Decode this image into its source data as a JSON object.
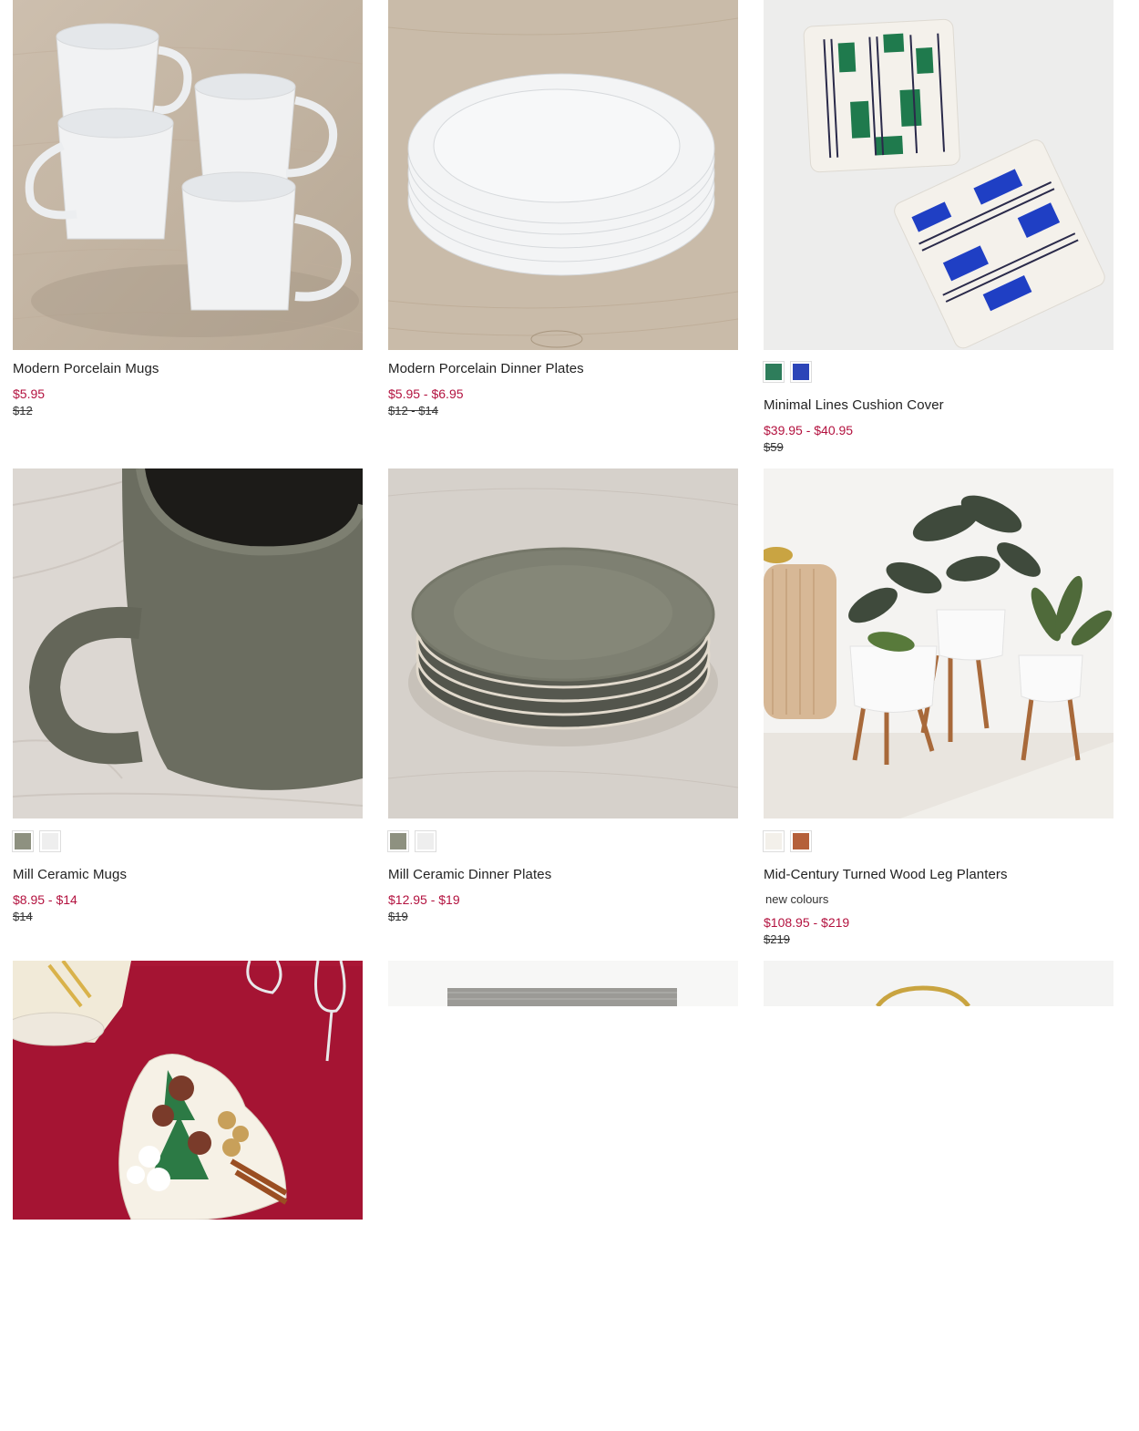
{
  "products": [
    {
      "title": "Modern Porcelain Mugs",
      "sale_price": "$5.95",
      "original_price": "$12",
      "image": "white-porcelain-mugs-image",
      "swatches": []
    },
    {
      "title": "Modern Porcelain Dinner Plates",
      "sale_price": "$5.95 - $6.95",
      "original_price": "$12 - $14",
      "image": "white-porcelain-plates-image",
      "swatches": []
    },
    {
      "title": "Minimal Lines Cushion Cover",
      "sale_price": "$39.95 - $40.95",
      "original_price": "$59",
      "image": "cushion-covers-image",
      "swatches": [
        {
          "color": "#2e7d5b",
          "name": "green"
        },
        {
          "color": "#2c45b8",
          "name": "blue"
        }
      ]
    },
    {
      "title": "Mill Ceramic Mugs",
      "sale_price": "$8.95 - $14",
      "original_price": "$14",
      "image": "olive-ceramic-mug-image",
      "swatches": [
        {
          "color": "#8e9180",
          "name": "olive"
        },
        {
          "color": "#eeeeee",
          "name": "white"
        }
      ]
    },
    {
      "title": "Mill Ceramic Dinner Plates",
      "sale_price": "$12.95 - $19",
      "original_price": "$19",
      "image": "olive-ceramic-plates-image",
      "swatches": [
        {
          "color": "#8e9180",
          "name": "olive"
        },
        {
          "color": "#eeeeee",
          "name": "white"
        }
      ]
    },
    {
      "title": "Mid-Century Turned Wood Leg Planters",
      "note": "new colours",
      "sale_price": "$108.95 - $219",
      "original_price": "$219",
      "image": "planters-image",
      "swatches": [
        {
          "color": "#f3f0ea",
          "name": "white"
        },
        {
          "color": "#b5603a",
          "name": "terracotta"
        }
      ]
    },
    {
      "title": "",
      "image": "christmas-tree-platter-image"
    },
    {
      "title": "",
      "image": "grey-rug-image"
    },
    {
      "title": "",
      "image": "brass-mirror-image"
    }
  ],
  "colors": {
    "sale": "#b3123f",
    "text": "#222222"
  }
}
